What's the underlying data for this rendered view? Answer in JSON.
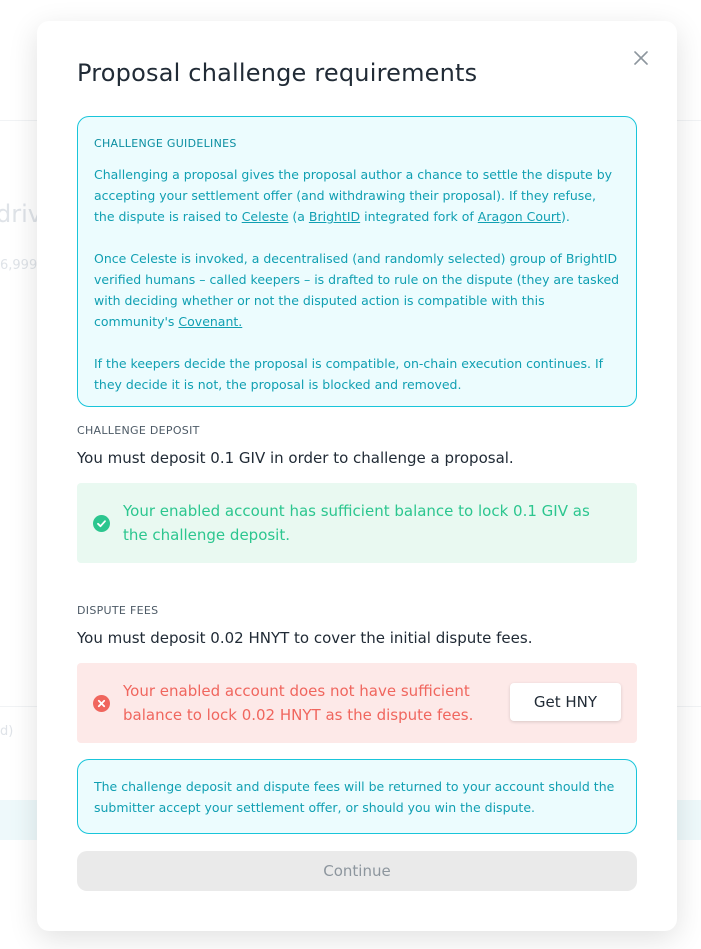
{
  "background": {
    "partial_title": "driv",
    "partial_amount": "6,999",
    "partial_label": "d)"
  },
  "modal": {
    "title": "Proposal challenge requirements",
    "close_icon": "close-icon"
  },
  "guidelines": {
    "heading": "CHALLENGE GUIDELINES",
    "p1_text_a": "Challenging a proposal gives the proposal author a chance to settle the dispute by accepting your settlement offer (and withdrawing their proposal). If they refuse, the dispute is raised to ",
    "p1_link_celeste": "Celeste",
    "p1_text_b": " (a ",
    "p1_link_brightid": "BrightID",
    "p1_text_c": " integrated fork of ",
    "p1_link_aragon": "Aragon Court",
    "p1_text_d": ").",
    "p2_text": "Once Celeste is invoked, a decentralised (and randomly selected) group of BrightID verified humans – called keepers – is drafted to rule on the dispute (they are tasked with deciding whether or not the disputed action is compatible with this community's ",
    "p2_link_covenant": "Covenant.",
    "p3_text": "If the keepers decide the proposal is compatible, on-chain execution continues. If they decide it is not, the proposal is blocked and removed."
  },
  "deposit": {
    "label": "CHALLENGE DEPOSIT",
    "text": "You must deposit 0.1 GIV in order to challenge a proposal.",
    "status_text": "Your enabled account has sufficient balance to lock 0.1 GIV as the challenge deposit.",
    "status_icon": "check-circle-icon",
    "status_color": "#2cc68f"
  },
  "fees": {
    "label": "DISPUTE FEES",
    "text": "You must deposit 0.02 HNYT to cover the initial dispute fees.",
    "status_text": "Your enabled account does not have sufficient balance to lock 0.02 HNYT as the dispute fees.",
    "status_icon": "error-circle-icon",
    "status_color": "#f0665e",
    "action_label": "Get HNY"
  },
  "notice": {
    "text": "The challenge deposit and dispute fees will be returned to your account should the submitter accept your settlement offer, or should you win the dispute."
  },
  "footer": {
    "continue_label": "Continue"
  }
}
